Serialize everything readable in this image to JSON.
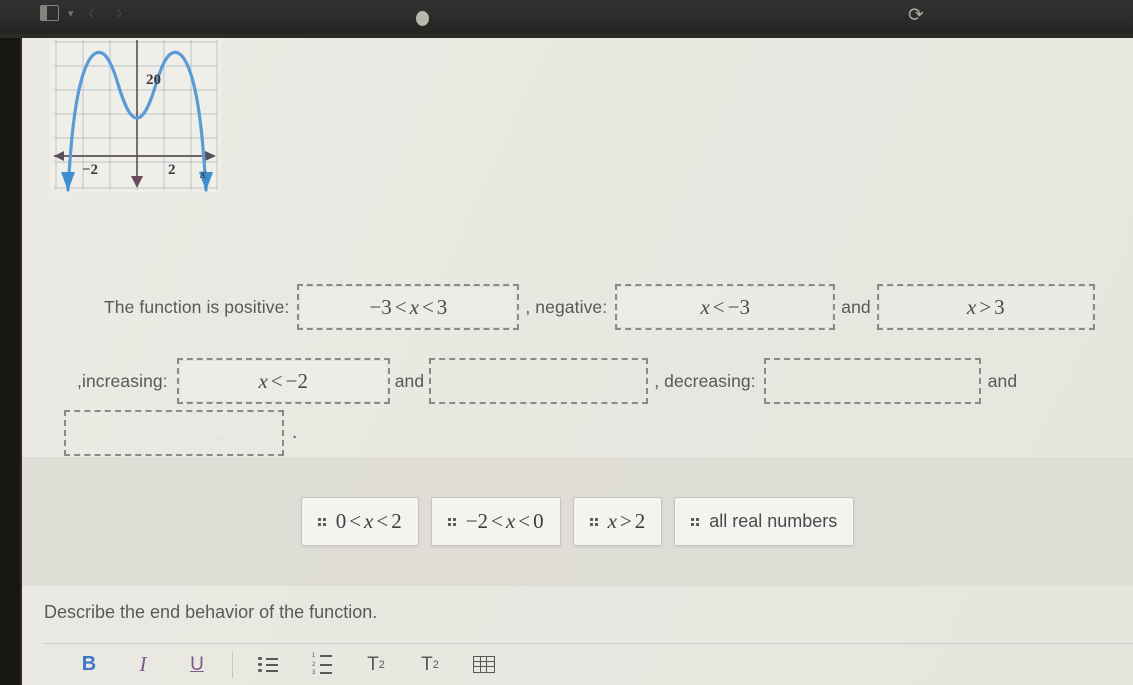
{
  "browser": {
    "sidebar_toggle_icon": "sidebar-toggle-icon",
    "caret_icon": "chevron-down-icon",
    "back_icon": "chevron-left-icon",
    "forward_icon": "chevron-right-icon",
    "status_dot_icon": "status-dot-icon",
    "reload_icon": "reload-icon"
  },
  "graph": {
    "alt": "Quartic polynomial graph with W shape opening downward",
    "y_label": "20",
    "x_label": "x",
    "x_tick_left": "−2",
    "x_tick_right": "2",
    "curve_color": "#5b9bd5",
    "grid_color": "#b9c4cc",
    "axis_color": "#585058"
  },
  "question": {
    "lbl_positive": "The function is positive:",
    "lbl_negative": ", negative:",
    "and_1": "and",
    "lbl_increasing": ",increasing:",
    "and_2": "and",
    "lbl_decreasing": ", decreasing:",
    "and_3": "and",
    "period": "."
  },
  "blanks": {
    "positive": "−3 < x < 3",
    "positive_parts": {
      "a": "−3",
      "op1": "<",
      "v": "x",
      "op2": "<",
      "b": "3"
    },
    "negative_parts": {
      "v": "x",
      "op": "<",
      "b": "−3"
    },
    "pos_and_parts": {
      "v": "x",
      "op": ">",
      "b": "3"
    },
    "increasing_parts": {
      "v": "x",
      "op": "<",
      "b": "−2"
    },
    "inc_and": "",
    "decreasing": "",
    "final": ""
  },
  "choices": [
    {
      "id": "choice-0-x-2",
      "type": "math",
      "parts": {
        "a": "0",
        "op1": "<",
        "v": "x",
        "op2": "<",
        "b": "2"
      }
    },
    {
      "id": "choice-neg2-x-0",
      "type": "math",
      "parts": {
        "a": "−2",
        "op1": "<",
        "v": "x",
        "op2": "<",
        "b": "0"
      }
    },
    {
      "id": "choice-x-gt-2",
      "type": "math2",
      "parts": {
        "v": "x",
        "op": ">",
        "b": "2"
      }
    },
    {
      "id": "choice-all-real",
      "type": "text",
      "label": "all real numbers"
    }
  ],
  "prompt": "Describe the end behavior of the function.",
  "toolbar": [
    {
      "name": "bold-button",
      "label": "B"
    },
    {
      "name": "italic-button",
      "label": "I"
    },
    {
      "name": "underline-button",
      "label": "U"
    },
    {
      "name": "bulleted-list-button",
      "label": ""
    },
    {
      "name": "numbered-list-button",
      "label": ""
    },
    {
      "name": "superscript-button",
      "label": "T"
    },
    {
      "name": "subscript-button",
      "label": "T"
    },
    {
      "name": "table-button",
      "label": ""
    }
  ],
  "toolbar_superscript": "2",
  "toolbar_subscript": "2"
}
